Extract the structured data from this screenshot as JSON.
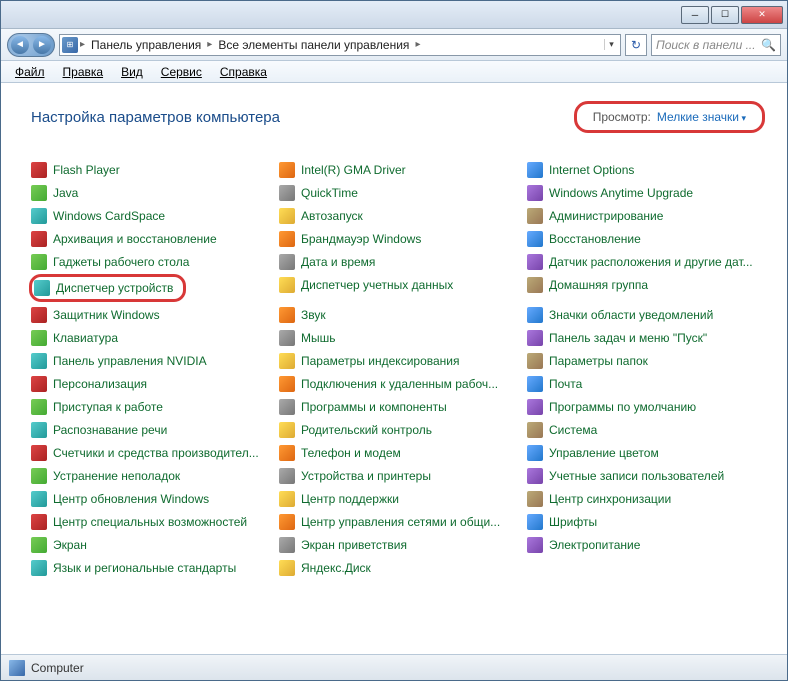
{
  "breadcrumbs": {
    "seg1": "Панель управления",
    "seg2": "Все элементы панели управления"
  },
  "search": {
    "placeholder": "Поиск в панели ..."
  },
  "menus": {
    "file": "Файл",
    "edit": "Правка",
    "view": "Вид",
    "tools": "Сервис",
    "help": "Справка"
  },
  "heading": "Настройка параметров компьютера",
  "view_label": "Просмотр:",
  "view_value": "Мелкие значки",
  "items_col1": [
    "Flash Player",
    "Java",
    "Windows CardSpace",
    "Архивация и восстановление",
    "Гаджеты рабочего стола",
    "Диспетчер устройств",
    "Защитник Windows",
    "Клавиатура",
    "Панель управления NVIDIA",
    "Персонализация",
    "Приступая к работе",
    "Распознавание речи",
    "Счетчики и средства производител...",
    "Устранение неполадок",
    "Центр обновления Windows",
    "Центр специальных возможностей",
    "Экран",
    "Язык и региональные стандарты"
  ],
  "items_col2": [
    "Intel(R) GMA Driver",
    "QuickTime",
    "Автозапуск",
    "Брандмауэр Windows",
    "Дата и время",
    "Диспетчер учетных данных",
    "Звук",
    "Мышь",
    "Параметры индексирования",
    "Подключения к удаленным рабоч...",
    "Программы и компоненты",
    "Родительский контроль",
    "Телефон и модем",
    "Устройства и принтеры",
    "Центр поддержки",
    "Центр управления сетями и общи...",
    "Экран приветствия",
    "Яндекс.Диск"
  ],
  "items_col3": [
    "Internet Options",
    "Windows Anytime Upgrade",
    "Администрирование",
    "Восстановление",
    "Датчик расположения и другие дат...",
    "Домашняя группа",
    "Значки области уведомлений",
    "Панель задач и меню \"Пуск\"",
    "Параметры папок",
    "Почта",
    "Программы по умолчанию",
    "Система",
    "Управление цветом",
    "Учетные записи пользователей",
    "Центр синхронизации",
    "Шрифты",
    "Электропитание"
  ],
  "highlight_index": 5,
  "status": "Computer"
}
